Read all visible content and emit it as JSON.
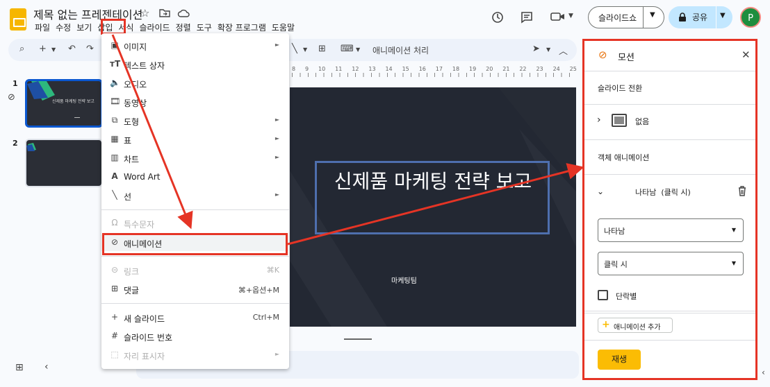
{
  "app": {
    "doc_title": "제목 없는 프레젠테이션",
    "menus": [
      "파일",
      "수정",
      "보기",
      "삽입",
      "서식",
      "슬라이드",
      "정렬",
      "도구",
      "확장 프로그램",
      "도움말"
    ],
    "slideshow_label": "슬라이드쇼",
    "share_label": "공유",
    "avatar_letter": "P"
  },
  "toolbar": {
    "zoom_glyph": "🔍",
    "animation_label": "애니메이션 처리"
  },
  "ruler": {
    "ticks": [
      "8",
      "9",
      "10",
      "11",
      "12",
      "13",
      "14",
      "15",
      "16",
      "17",
      "18",
      "19",
      "20",
      "21",
      "22",
      "23",
      "24",
      "25"
    ]
  },
  "filmstrip": {
    "slides": [
      {
        "number": "1",
        "title": "신제품 마케팅 전략 보고"
      },
      {
        "number": "2",
        "title": ""
      }
    ]
  },
  "slide": {
    "title": "신제품 마케팅 전략 보고",
    "subtitle": "마케팅팀"
  },
  "insert_menu": {
    "items": [
      {
        "label": "이미지",
        "submenu": "►"
      },
      {
        "label": "텍스트 상자"
      },
      {
        "label": "오디오"
      },
      {
        "label": "동영상"
      },
      {
        "label": "도형",
        "submenu": "►"
      },
      {
        "label": "표",
        "submenu": "►"
      },
      {
        "label": "차트",
        "submenu": "►"
      },
      {
        "label": "Word Art"
      },
      {
        "label": "선",
        "submenu": "►"
      },
      {
        "label": "특수문자"
      },
      {
        "label": "애니메이션"
      },
      {
        "label": "링크",
        "shortcut": "⌘K"
      },
      {
        "label": "댓글",
        "shortcut": "⌘+옵션+M"
      },
      {
        "label": "새 슬라이드",
        "shortcut": "Ctrl+M"
      },
      {
        "label": "슬라이드 번호"
      },
      {
        "label": "자리 표시자",
        "submenu": "►"
      }
    ]
  },
  "motion_panel": {
    "title": "모션",
    "slide_transition_label": "슬라이드 전환",
    "transition_value": "없음",
    "object_animation_label": "객체 애니메이션",
    "animation_item": "나타남  (클릭 시)",
    "effect_value": "나타남",
    "trigger_value": "클릭 시",
    "by_paragraph_label": "단락별",
    "add_animation_label": "애니메이션 추가",
    "play_label": "재생"
  },
  "colors": {
    "accent_red": "#e53425",
    "play_button": "#fbbc04",
    "share_button": "#c2e7ff",
    "slide_bg": "#232833"
  }
}
